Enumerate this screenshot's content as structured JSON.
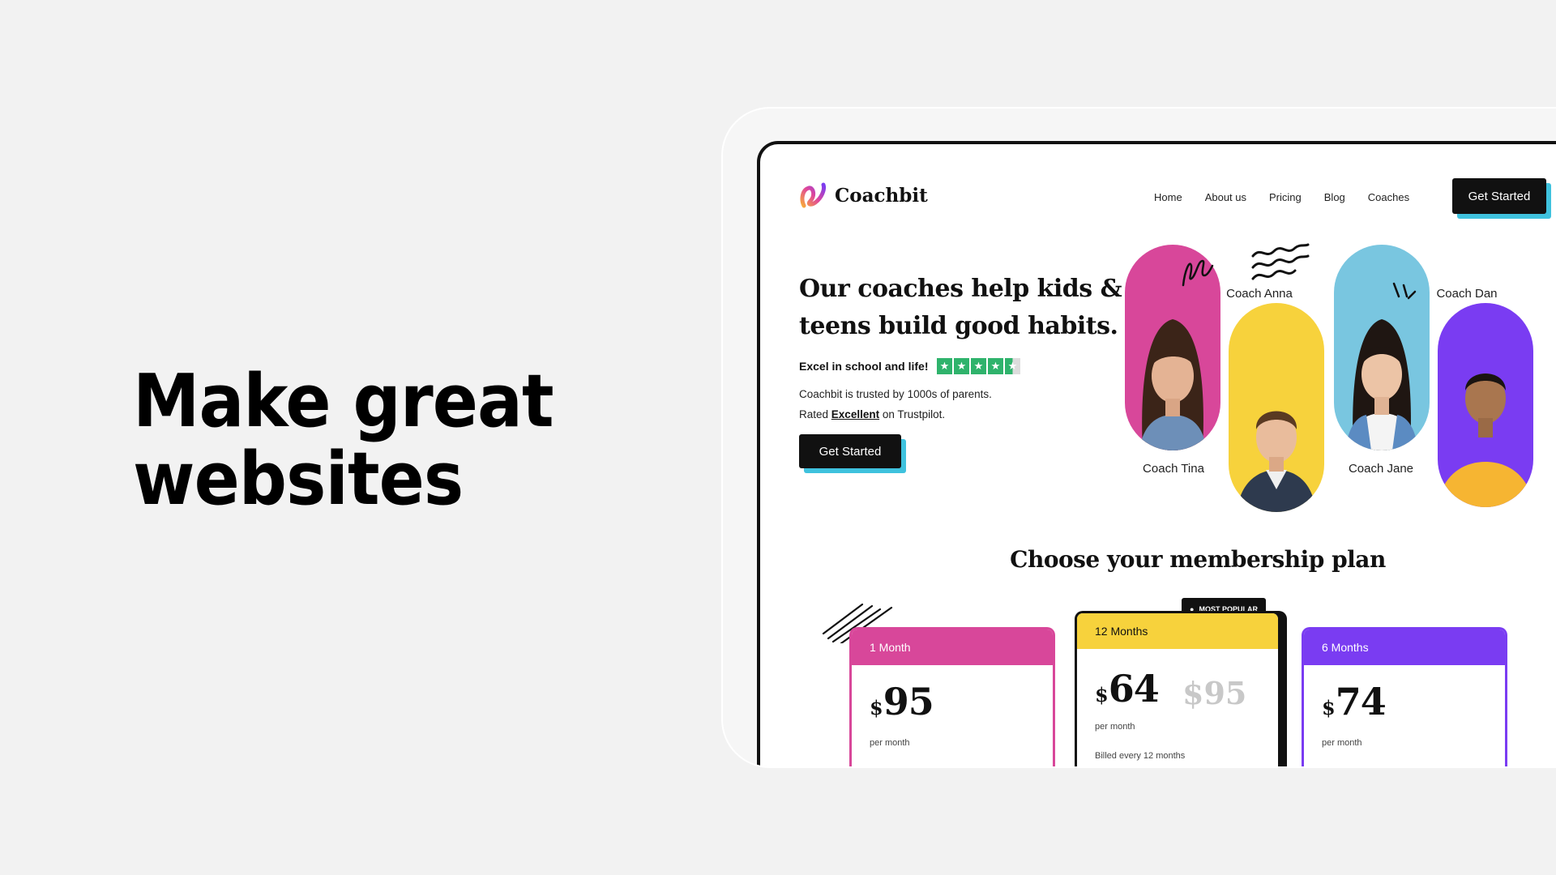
{
  "headline": {
    "line1": "Make great",
    "line2": "websites"
  },
  "site": {
    "logo_text": "Coachbit",
    "nav": [
      "Home",
      "About us",
      "Pricing",
      "Blog",
      "Coaches"
    ],
    "nav_cta": "Get Started"
  },
  "hero": {
    "title": "Our coaches help kids & teens build good habits.",
    "subtitle": "Excel in school and life!",
    "trust_line1": "Coachbit is trusted by 1000s of parents.",
    "rated_prefix": "Rated",
    "rated_word": "Excellent",
    "rated_suffix": "on Trustpilot.",
    "rating_stars": 4.5,
    "cta": "Get Started"
  },
  "coaches": [
    {
      "name": "Coach Tina",
      "color": "#d8479a"
    },
    {
      "name": "Coach Anna",
      "color": "#f7d23c"
    },
    {
      "name": "Coach Jane",
      "color": "#79c6e0"
    },
    {
      "name": "Coach Dan",
      "color": "#7a3cf2"
    }
  ],
  "pricing": {
    "title": "Choose your membership plan",
    "badge": "MOST POPULAR",
    "plans": [
      {
        "name": "1 Month",
        "currency": "$",
        "price": "95",
        "period": "per month",
        "color": "#d8479a"
      },
      {
        "name": "12 Months",
        "currency": "$",
        "price": "64",
        "old_price": "$95",
        "period": "per month",
        "billing": "Billed every 12 months",
        "color": "#f7d23c"
      },
      {
        "name": "6 Months",
        "currency": "$",
        "price": "74",
        "period": "per month",
        "color": "#7a3cf2"
      }
    ]
  }
}
